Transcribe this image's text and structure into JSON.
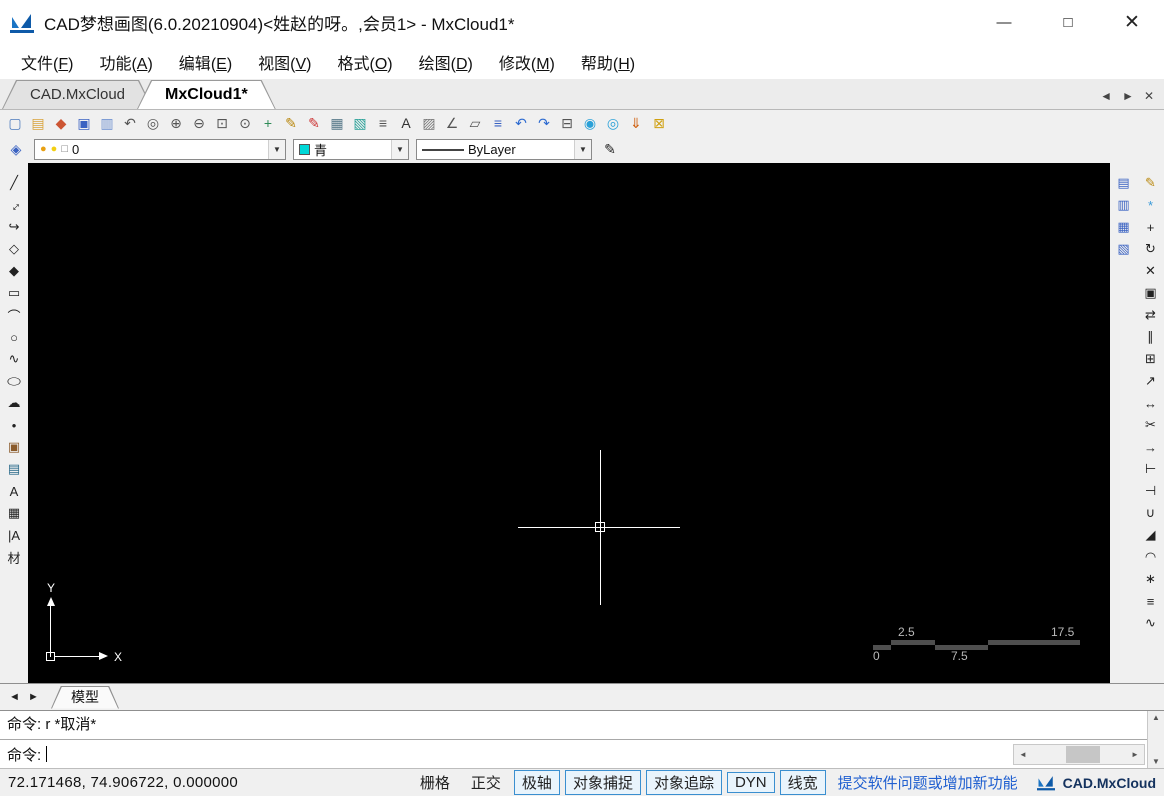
{
  "window": {
    "title": "CAD梦想画图(6.0.20210904)<姓赵的呀。,会员1> - MxCloud1*",
    "controls": [
      {
        "name": "minimize-button",
        "glyph": "—"
      },
      {
        "name": "maximize-button",
        "glyph": "□"
      },
      {
        "name": "close-button",
        "glyph": "✕"
      }
    ]
  },
  "menu_bar": {
    "items": [
      {
        "name": "menu-file",
        "text": "文件",
        "mnemonic": "F"
      },
      {
        "name": "menu-function",
        "text": "功能",
        "mnemonic": "A"
      },
      {
        "name": "menu-edit",
        "text": "编辑",
        "mnemonic": "E"
      },
      {
        "name": "menu-view",
        "text": "视图",
        "mnemonic": "V"
      },
      {
        "name": "menu-format",
        "text": "格式",
        "mnemonic": "O"
      },
      {
        "name": "menu-draw",
        "text": "绘图",
        "mnemonic": "D"
      },
      {
        "name": "menu-modify",
        "text": "修改",
        "mnemonic": "M"
      },
      {
        "name": "menu-help",
        "text": "帮助",
        "mnemonic": "H"
      }
    ]
  },
  "document_tabs": {
    "tabs": [
      {
        "label": "CAD.MxCloud",
        "active": false
      },
      {
        "label": "MxCloud1*",
        "active": true
      }
    ],
    "controls": [
      {
        "name": "tab-scroll-left-button",
        "glyph": "◄"
      },
      {
        "name": "tab-scroll-right-button",
        "glyph": "►"
      },
      {
        "name": "tab-close-button",
        "glyph": "✕"
      }
    ]
  },
  "toolbar_main": {
    "icons": [
      {
        "name": "new-file-icon",
        "glyph": "▢",
        "color": "#4d7bbd"
      },
      {
        "name": "open-file-icon",
        "glyph": "▤",
        "color": "#d8a33c"
      },
      {
        "name": "cloud-open-icon",
        "glyph": "◆",
        "color": "#cc5533"
      },
      {
        "name": "save-icon",
        "glyph": "▣",
        "color": "#3a62c2"
      },
      {
        "name": "save-as-icon",
        "glyph": "▥",
        "color": "#6c8fd0"
      },
      {
        "name": "zoom-previous-icon",
        "glyph": "↶",
        "color": "#555555"
      },
      {
        "name": "zoom-realtime-icon",
        "glyph": "◎",
        "color": "#555555"
      },
      {
        "name": "zoom-in-icon",
        "glyph": "⊕",
        "color": "#555555"
      },
      {
        "name": "zoom-out-icon",
        "glyph": "⊖",
        "color": "#555555"
      },
      {
        "name": "zoom-window-icon",
        "glyph": "⊡",
        "color": "#555555"
      },
      {
        "name": "zoom-extents-icon",
        "glyph": "⊙",
        "color": "#555555"
      },
      {
        "name": "pan-icon",
        "glyph": "+",
        "color": "#2e8b57"
      },
      {
        "name": "pencil-edit-icon",
        "glyph": "✎",
        "color": "#b8860b"
      },
      {
        "name": "redline-icon",
        "glyph": "✎",
        "color": "#cc3333"
      },
      {
        "name": "table-icon",
        "glyph": "▦",
        "color": "#557788"
      },
      {
        "name": "layer-properties-icon",
        "glyph": "▧",
        "color": "#2aa198"
      },
      {
        "name": "linetype-manager-icon",
        "glyph": "≡",
        "color": "#555555"
      },
      {
        "name": "text-style-icon",
        "glyph": "A",
        "color": "#333333"
      },
      {
        "name": "image-attach-icon",
        "glyph": "▨",
        "color": "#777777"
      },
      {
        "name": "measure-icon",
        "glyph": "∠",
        "color": "#555555"
      },
      {
        "name": "area-icon",
        "glyph": "▱",
        "color": "#555555"
      },
      {
        "name": "properties-panel-icon",
        "glyph": "≡",
        "color": "#3a62c2"
      },
      {
        "name": "undo-icon",
        "glyph": "↶",
        "color": "#2e6bd0"
      },
      {
        "name": "redo-icon",
        "glyph": "↷",
        "color": "#2e6bd0"
      },
      {
        "name": "plot-icon",
        "glyph": "⊟",
        "color": "#555555"
      },
      {
        "name": "web-home-icon",
        "glyph": "◉",
        "color": "#2aa1d8"
      },
      {
        "name": "cloud-service-icon",
        "glyph": "◎",
        "color": "#2aa1d8"
      },
      {
        "name": "pdf-export-icon",
        "glyph": "⇓",
        "color": "#d06010"
      },
      {
        "name": "app-options-icon",
        "glyph": "⊠",
        "color": "#d0a010"
      }
    ]
  },
  "toolbar_properties": {
    "layer_manager_icon": {
      "name": "layer-manager-icon",
      "glyph": "◈",
      "color": "#3a62c2"
    },
    "dropdown_arrow": "▼",
    "layer_combo": {
      "value": "0",
      "icons": [
        {
          "name": "layer-on-icon",
          "glyph": "●",
          "color": "#e8a013"
        },
        {
          "name": "layer-freeze-icon",
          "glyph": "●",
          "color": "#f3cf12"
        },
        {
          "name": "layer-color-swatch",
          "glyph": "□",
          "color": "#777777"
        }
      ]
    },
    "color_combo": {
      "value": "青",
      "swatch_color": "#00d8d8"
    },
    "linetype_combo": {
      "value": "ByLayer"
    },
    "match_properties_icon": {
      "name": "match-properties-icon",
      "glyph": "✎",
      "color": "#222222"
    }
  },
  "left_toolbar": {
    "icons": [
      {
        "name": "line-icon",
        "glyph": "╱",
        "color": "#222222"
      },
      {
        "name": "construction-line-icon",
        "glyph": "↔",
        "color": "#222222",
        "cls": "rot45"
      },
      {
        "name": "polyline-icon",
        "glyph": "↪",
        "color": "#222222"
      },
      {
        "name": "polygon-icon",
        "glyph": "◇",
        "color": "#222222"
      },
      {
        "name": "filled-polygon-icon",
        "glyph": "◆",
        "color": "#222222"
      },
      {
        "name": "rectangle-icon",
        "glyph": "▭",
        "color": "#222222"
      },
      {
        "name": "arc-icon",
        "glyph": "⌒",
        "color": "#222222"
      },
      {
        "name": "circle-icon",
        "glyph": "○",
        "color": "#222222"
      },
      {
        "name": "spline-icon",
        "glyph": "∿",
        "color": "#222222"
      },
      {
        "name": "ellipse-icon",
        "glyph": "◯",
        "color": "#222222",
        "cls": "squish"
      },
      {
        "name": "revision-cloud-icon",
        "glyph": "☁",
        "color": "#222222"
      },
      {
        "name": "point-icon",
        "glyph": "•",
        "color": "#222222"
      },
      {
        "name": "insert-block-icon",
        "glyph": "▣",
        "color": "#8a5a2a"
      },
      {
        "name": "create-block-icon",
        "glyph": "▤",
        "color": "#2a6a8a"
      },
      {
        "name": "text-icon",
        "glyph": "A",
        "color": "#222222"
      },
      {
        "name": "hatch-icon",
        "glyph": "▦",
        "color": "#222222"
      },
      {
        "name": "aligned-text-icon",
        "glyph": "|A",
        "color": "#222222"
      },
      {
        "name": "material-icon",
        "glyph": "材",
        "color": "#222222"
      }
    ]
  },
  "right_toolbar": {
    "secondary_icons": [
      {
        "name": "window-cascade-icon",
        "glyph": "▤",
        "color": "#3a62c2"
      },
      {
        "name": "window-tile-icon",
        "glyph": "▥",
        "color": "#3a62c2"
      },
      {
        "name": "window-vertical-icon",
        "glyph": "▦",
        "color": "#3a62c2"
      },
      {
        "name": "window-horizontal-icon",
        "glyph": "▧",
        "color": "#3a62c2"
      }
    ],
    "primary_icons": [
      {
        "name": "brush-icon",
        "glyph": "✎",
        "color": "#b8860b"
      },
      {
        "name": "format-painter-icon",
        "glyph": "*",
        "color": "#3a9ad8"
      },
      {
        "name": "move-icon",
        "glyph": "+",
        "color": "#222222"
      },
      {
        "name": "rotate-icon",
        "glyph": "↻",
        "color": "#222222"
      },
      {
        "name": "erase-icon",
        "glyph": "✕",
        "color": "#222222"
      },
      {
        "name": "copy-icon",
        "glyph": "▣",
        "color": "#222222"
      },
      {
        "name": "mirror-icon",
        "glyph": "⇄",
        "color": "#222222"
      },
      {
        "name": "offset-icon",
        "glyph": "∥",
        "color": "#222222"
      },
      {
        "name": "array-icon",
        "glyph": "⊞",
        "color": "#222222"
      },
      {
        "name": "scale-icon",
        "glyph": "↗",
        "color": "#222222"
      },
      {
        "name": "stretch-icon",
        "glyph": "↔",
        "color": "#222222"
      },
      {
        "name": "trim-icon",
        "glyph": "✂",
        "color": "#222222"
      },
      {
        "name": "extend-icon",
        "glyph": "→",
        "color": "#222222"
      },
      {
        "name": "break-at-point-icon",
        "glyph": "⊢",
        "color": "#222222"
      },
      {
        "name": "break-icon",
        "glyph": "⊣",
        "color": "#222222"
      },
      {
        "name": "join-icon",
        "glyph": "∪",
        "color": "#222222"
      },
      {
        "name": "chamfer-icon",
        "glyph": "◢",
        "color": "#222222"
      },
      {
        "name": "fillet-icon",
        "glyph": "◠",
        "color": "#222222"
      },
      {
        "name": "explode-icon",
        "glyph": "∗",
        "color": "#222222"
      },
      {
        "name": "align-icon",
        "glyph": "≡",
        "color": "#222222"
      },
      {
        "name": "polyline-edit-icon",
        "glyph": "∿",
        "color": "#222222"
      }
    ]
  },
  "canvas": {
    "ucs": {
      "x_label": "X",
      "y_label": "Y"
    },
    "scale_ruler": {
      "zero": "0",
      "q1": "2.5",
      "mid": "7.5",
      "end": "17.5"
    }
  },
  "sheet_bar": {
    "nav": [
      {
        "name": "sheet-prev-button",
        "glyph": "◄"
      },
      {
        "name": "sheet-next-button",
        "glyph": "►"
      }
    ],
    "tab_label": "模型"
  },
  "command_panel": {
    "history": "命令: r *取消*",
    "prompt": "命令:",
    "scroll": {
      "up": "▲",
      "down": "▼",
      "left": "◄",
      "right": "►"
    }
  },
  "status_bar": {
    "coordinates": "72.171468, 74.906722, 0.000000",
    "toggles": [
      {
        "label": "栅格",
        "active": false
      },
      {
        "label": "正交",
        "active": false
      },
      {
        "label": "极轴",
        "active": true
      },
      {
        "label": "对象捕捉",
        "active": true
      },
      {
        "label": "对象追踪",
        "active": true
      },
      {
        "label": "DYN",
        "active": true
      },
      {
        "label": "线宽",
        "active": true
      }
    ],
    "feedback_link": "提交软件问题或增加新功能",
    "brand": "CAD.MxCloud"
  }
}
